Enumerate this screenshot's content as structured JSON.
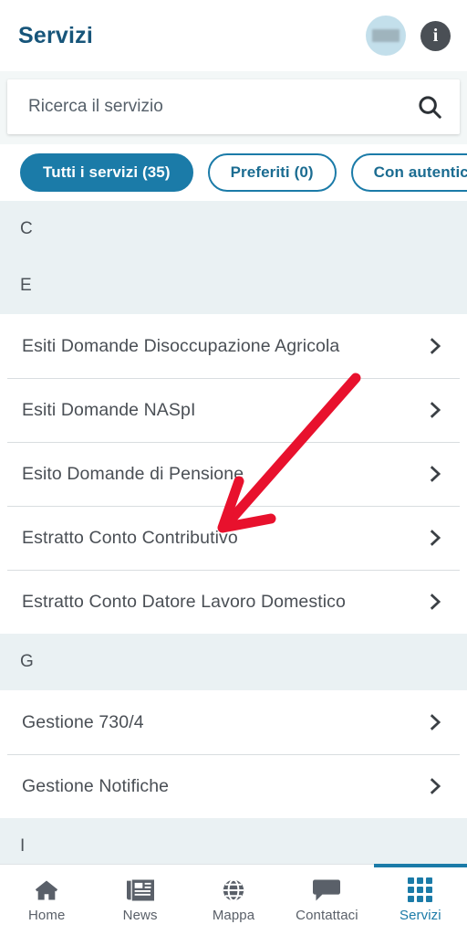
{
  "header": {
    "title": "Servizi",
    "avatar_icon": "avatar-redacted-icon",
    "info_icon": "info-icon"
  },
  "search": {
    "placeholder": "Ricerca il servizio",
    "value": "",
    "icon": "search-icon"
  },
  "filters": {
    "chips": [
      {
        "label": "Tutti i servizi (35)",
        "active": true
      },
      {
        "label": "Preferiti (0)",
        "active": false
      },
      {
        "label": "Con autenticazione",
        "active": false
      }
    ]
  },
  "list": {
    "sections": [
      {
        "letter": "C",
        "items": []
      },
      {
        "letter": "E",
        "items": [
          "Esiti Domande Disoccupazione Agricola",
          "Esiti Domande NASpI",
          "Esito Domande di Pensione",
          "Estratto Conto Contributivo",
          "Estratto Conto Datore Lavoro Domestico"
        ]
      },
      {
        "letter": "G",
        "items": [
          "Gestione 730/4",
          "Gestione Notifiche"
        ]
      },
      {
        "letter": "I",
        "items": []
      }
    ],
    "chevron_icon": "chevron-right-icon"
  },
  "annotation": {
    "type": "arrow",
    "color": "#e8112d",
    "points_to": "Estratto Conto Contributivo"
  },
  "bottom_nav": {
    "items": [
      {
        "label": "Home",
        "icon": "home-icon",
        "active": false
      },
      {
        "label": "News",
        "icon": "newspaper-icon",
        "active": false
      },
      {
        "label": "Mappa",
        "icon": "globe-icon",
        "active": false
      },
      {
        "label": "Contattaci",
        "icon": "chat-bubble-icon",
        "active": false
      },
      {
        "label": "Servizi",
        "icon": "grid-icon",
        "active": true
      }
    ]
  },
  "colors": {
    "brand_blue": "#1b7ba8",
    "title_blue": "#17557a",
    "section_bg": "#eaf1f3",
    "search_bg": "#f3f7f7",
    "text_gray": "#4a4f55",
    "annotation_red": "#e8112d"
  }
}
